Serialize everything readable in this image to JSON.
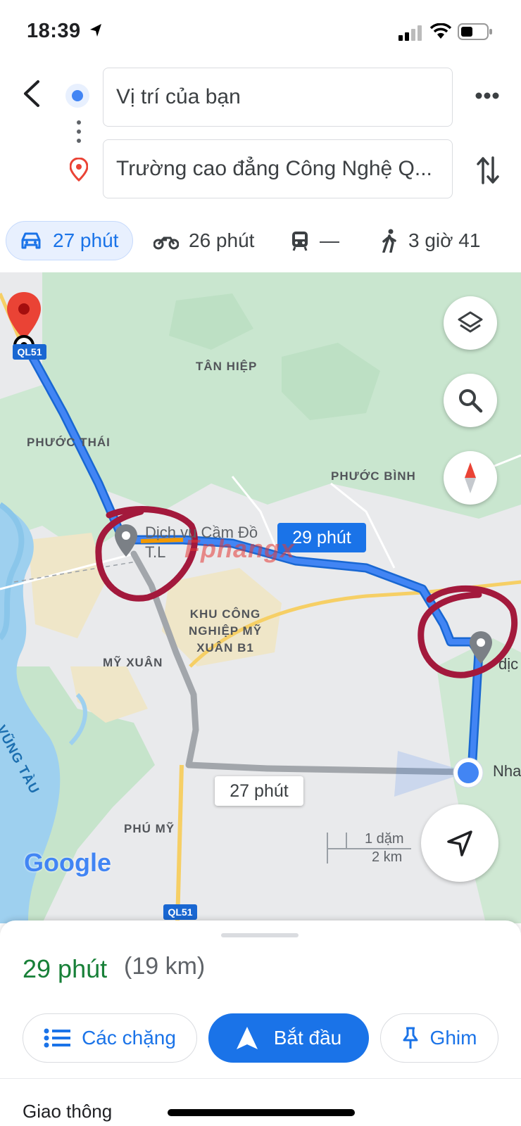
{
  "status_bar": {
    "time": "18:39"
  },
  "directions": {
    "origin": "Vị trí của bạn",
    "destination": "Trường cao đẳng Công Nghệ Q..."
  },
  "modes": [
    {
      "icon": "car-icon",
      "label": "27 phút"
    },
    {
      "icon": "motorbike-icon",
      "label": "26 phút"
    },
    {
      "icon": "transit-icon",
      "label": "—"
    },
    {
      "icon": "walk-icon",
      "label": "3 giờ 41"
    }
  ],
  "map": {
    "labels": {
      "tan_hiep": "TÂN HIỆP",
      "phuoc_thai": "PHƯỚC THÁI",
      "phuoc_binh": "PHƯỚC BÌNH",
      "kcn": "KHU CÔNG\nNGHIỆP MỸ\nXUÂN B1",
      "my_xuan": "MỸ XUÂN",
      "phu_my": "PHÚ MỸ",
      "vung_tau": "A - VŨNG TÀU",
      "poi": "Dịch vụ Cầm Đồ\nT.L",
      "nha": "Nha",
      "dic": "dịc",
      "road_top": "QL51",
      "road_bottom": "QL51",
      "google": "Google"
    },
    "route_main_label": "29 phút",
    "route_alt_label": "27 phút",
    "scale": {
      "miles": "1 dặm",
      "km": "2 km"
    },
    "watermark": "Fphangx"
  },
  "summary": {
    "duration": "29 phút",
    "distance": "(19 km)"
  },
  "actions": {
    "steps": "Các chặng",
    "start": "Bắt đầu",
    "pin": "Ghim"
  },
  "next_section": "Giao thông",
  "colors": {
    "accent": "#1a73e8",
    "route": "#4285f4",
    "duration_green": "#188038",
    "annotation": "#a3193c"
  }
}
